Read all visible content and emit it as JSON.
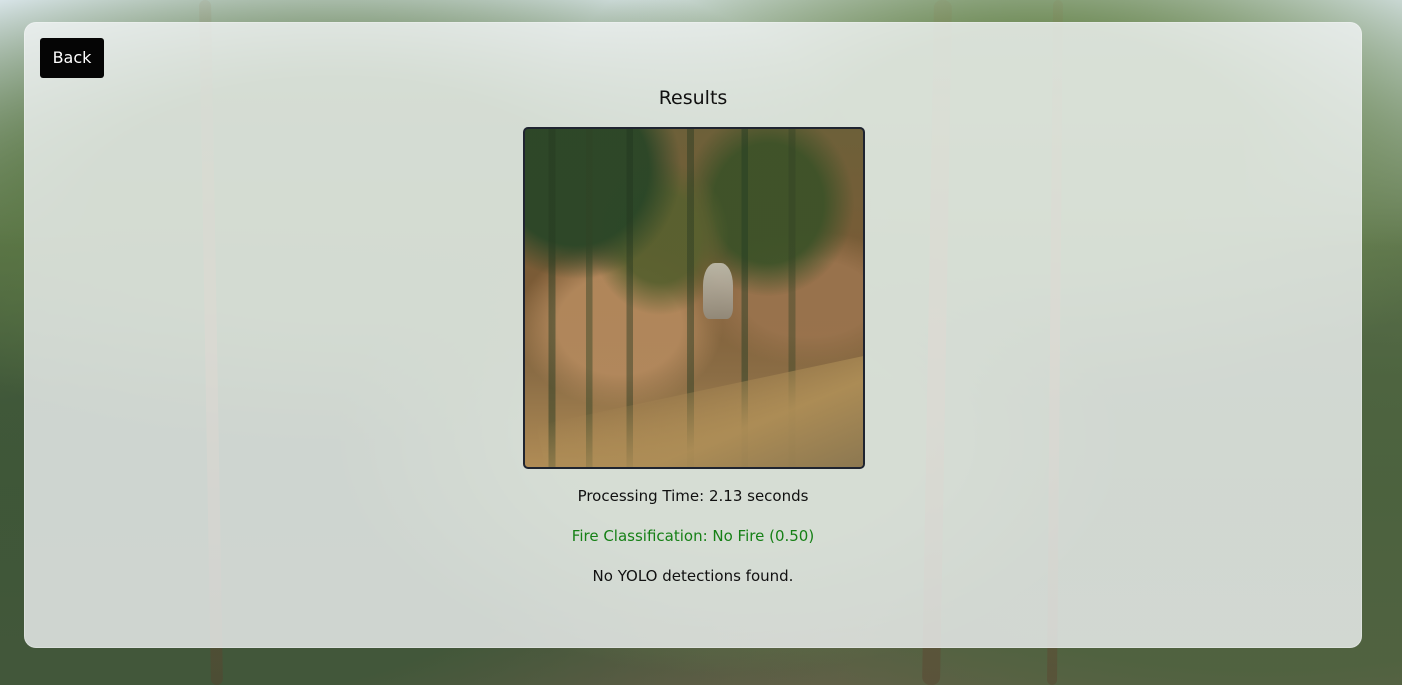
{
  "actions": {
    "back_label": "Back"
  },
  "results": {
    "title": "Results",
    "processing_time": "Processing Time: 2.13 seconds",
    "fire_classification": "Fire Classification: No Fire (0.50)",
    "yolo_detections": "No YOLO detections found."
  },
  "colors": {
    "button_background": "#050505",
    "button_text": "#ffffff",
    "classification_text": "#168016"
  },
  "icons": {
    "result_image": "forest-image"
  }
}
